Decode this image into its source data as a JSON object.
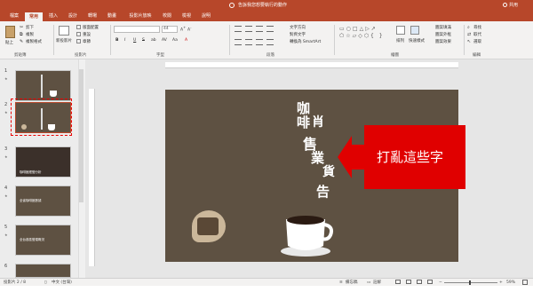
{
  "window": {
    "title": "告訴我您想要執行的動作",
    "share_label": "共用"
  },
  "tabs": [
    "檔案",
    "常用",
    "插入",
    "設計",
    "轉場",
    "動畫",
    "投影片放映",
    "校閱",
    "檢視",
    "說明"
  ],
  "ribbon": {
    "clipboard": {
      "paste": "貼上",
      "cut": "剪下",
      "copy": "複製",
      "format_painter": "複製格式",
      "label": "剪貼簿"
    },
    "slides": {
      "new_slide": "新投影片",
      "layout": "版面配置",
      "reset": "重設",
      "section": "章節",
      "label": "投影片"
    },
    "font": {
      "font_name": "",
      "font_size": "44",
      "label": "字型",
      "buttons": [
        "B",
        "I",
        "U",
        "S",
        "ab",
        "AV",
        "Aa",
        "A"
      ]
    },
    "paragraph": {
      "text_direction": "文字方向",
      "align_text": "對齊文字",
      "smartart": "轉換為 SmartArt",
      "label": "段落"
    },
    "drawing": {
      "arrange": "排列",
      "quick_styles": "快速樣式",
      "shape_fill": "圖案填滿",
      "shape_outline": "圖案外框",
      "shape_effects": "圖案效果",
      "label": "繪圖"
    },
    "editing": {
      "find": "尋找",
      "replace": "取代",
      "select": "選取",
      "label": "編輯"
    }
  },
  "thumbnails": [
    {
      "num": "1",
      "text": ""
    },
    {
      "num": "2",
      "text": ""
    },
    {
      "num": "3",
      "text": "咖啡館經營分析"
    },
    {
      "num": "4",
      "text": "全省咖啡館數據"
    },
    {
      "num": "5",
      "text": "全台各區營運概況"
    },
    {
      "num": "6",
      "text": ""
    }
  ],
  "slide": {
    "vertical_text": [
      "咖",
      "啡",
      "肖",
      "售",
      "業",
      "貨",
      "告"
    ],
    "callout_text": "打亂這些字"
  },
  "status": {
    "slide_info": "投影片 2 / 8",
    "language": "中文 (台灣)",
    "notes": "備忘稿",
    "comments": "註解",
    "zoom": "59%"
  },
  "colors": {
    "accent": "#b7472a",
    "slide_bg": "#5e5142",
    "callout": "#e00000"
  }
}
